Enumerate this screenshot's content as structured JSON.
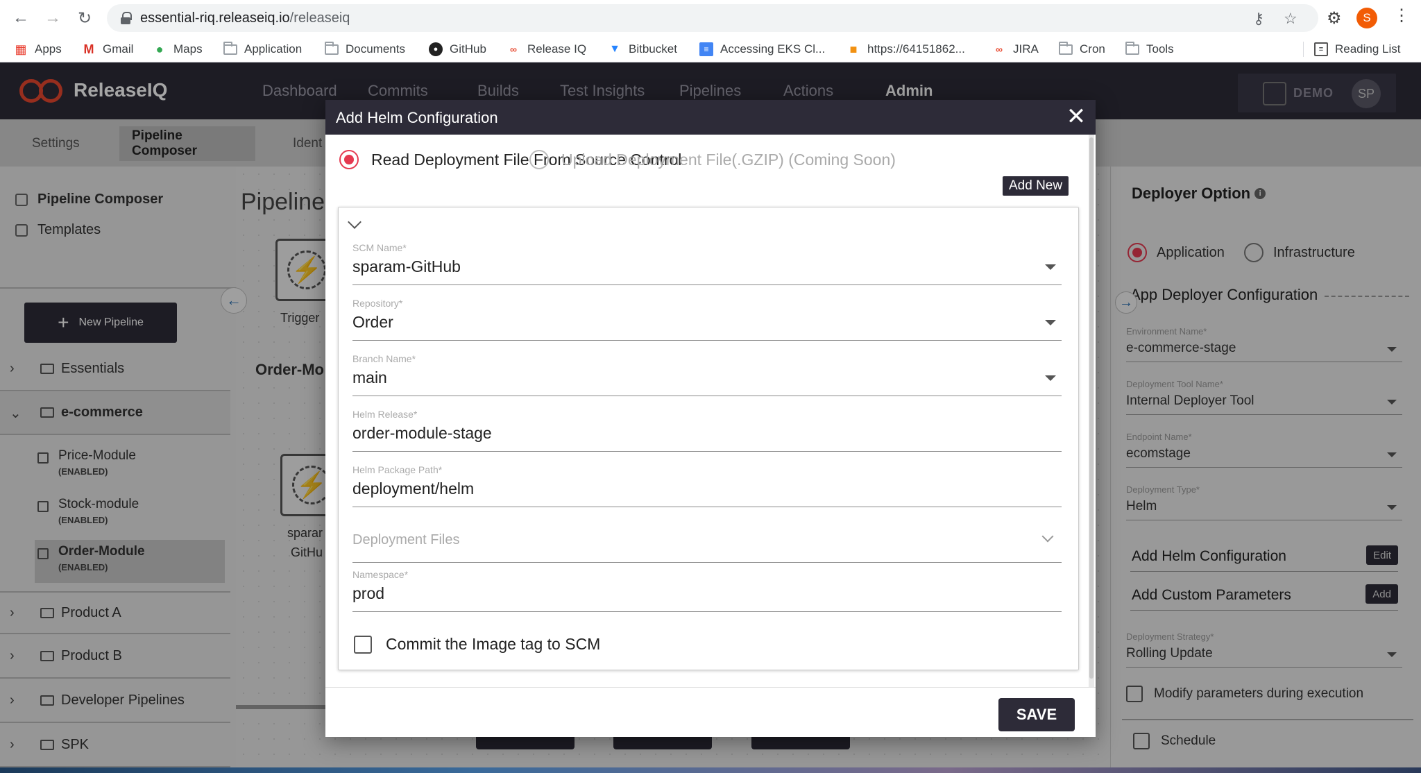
{
  "browser": {
    "url_host": "essential-riq.releaseiq.io",
    "url_path": "/releaseiq",
    "profile_initial": "S",
    "bookmarks": [
      "Apps",
      "Gmail",
      "Maps",
      "Application",
      "Documents",
      "GitHub",
      "Release IQ",
      "Bitbucket",
      "Accessing EKS Cl...",
      "https://64151862...",
      "JIRA",
      "Cron",
      "Tools"
    ],
    "reading_list": "Reading List"
  },
  "app": {
    "logo_text": "ReleaseIQ",
    "nav": [
      "Dashboard",
      "Commits",
      "Builds",
      "Test Insights",
      "Pipelines",
      "Actions",
      "Admin"
    ],
    "active_nav": "Admin",
    "demo_label": "DEMO",
    "user_initials": "SP"
  },
  "subtabs": [
    "Settings",
    "Pipeline Composer",
    "Ident"
  ],
  "sidebar": {
    "pipeline_composer": "Pipeline Composer",
    "templates": "Templates",
    "new_pipeline": "New Pipeline",
    "groups": [
      {
        "name": "Essentials",
        "expanded": false
      },
      {
        "name": "e-commerce",
        "expanded": true
      },
      {
        "name": "Product A",
        "expanded": false
      },
      {
        "name": "Product B",
        "expanded": false
      },
      {
        "name": "Developer Pipelines",
        "expanded": false
      },
      {
        "name": "SPK",
        "expanded": false
      }
    ],
    "modules": [
      {
        "name": "Price-Module",
        "status": "(ENABLED)"
      },
      {
        "name": "Stock-module",
        "status": "(ENABLED)"
      },
      {
        "name": "Order-Module",
        "status": "(ENABLED)"
      }
    ]
  },
  "canvas": {
    "title": "Pipeline",
    "trigger_label": "Trigger",
    "subtitle": "Order-Mo",
    "node_label_1": "sparar",
    "node_label_2": "GitHu"
  },
  "right_panel": {
    "title": "Deployer Option",
    "radio_application": "Application",
    "radio_infrastructure": "Infrastructure",
    "section": "App Deployer Configuration",
    "fields": [
      {
        "label": "Environment Name*",
        "value": "e-commerce-stage"
      },
      {
        "label": "Deployment Tool Name*",
        "value": "Internal Deployer Tool"
      },
      {
        "label": "Endpoint Name*",
        "value": "ecomstage"
      },
      {
        "label": "Deployment Type*",
        "value": "Helm"
      }
    ],
    "add_helm": {
      "label": "Add Helm Configuration",
      "button": "Edit"
    },
    "add_custom": {
      "label": "Add Custom Parameters",
      "button": "Add"
    },
    "strategy": {
      "label": "Deployment Strategy*",
      "value": "Rolling Update"
    },
    "modify_params": "Modify parameters during execution",
    "schedule": "Schedule"
  },
  "modal": {
    "title": "Add Helm Configuration",
    "radio_source": "Read Deployment File From Source Control",
    "radio_upload": "Upload Deployment File(.GZIP) (Coming Soon)",
    "add_new": "Add New",
    "fields": {
      "scm_name": {
        "label": "SCM Name*",
        "value": "sparam-GitHub"
      },
      "repository": {
        "label": "Repository*",
        "value": "Order"
      },
      "branch": {
        "label": "Branch Name*",
        "value": "main"
      },
      "helm_release": {
        "label": "Helm Release*",
        "value": "order-module-stage"
      },
      "helm_path": {
        "label": "Helm Package Path*",
        "value": "deployment/helm"
      },
      "deployment_files": {
        "placeholder": "Deployment Files"
      },
      "namespace": {
        "label": "Namespace*",
        "value": "prod"
      }
    },
    "commit_image": "Commit the Image tag to SCM",
    "save": "SAVE"
  }
}
